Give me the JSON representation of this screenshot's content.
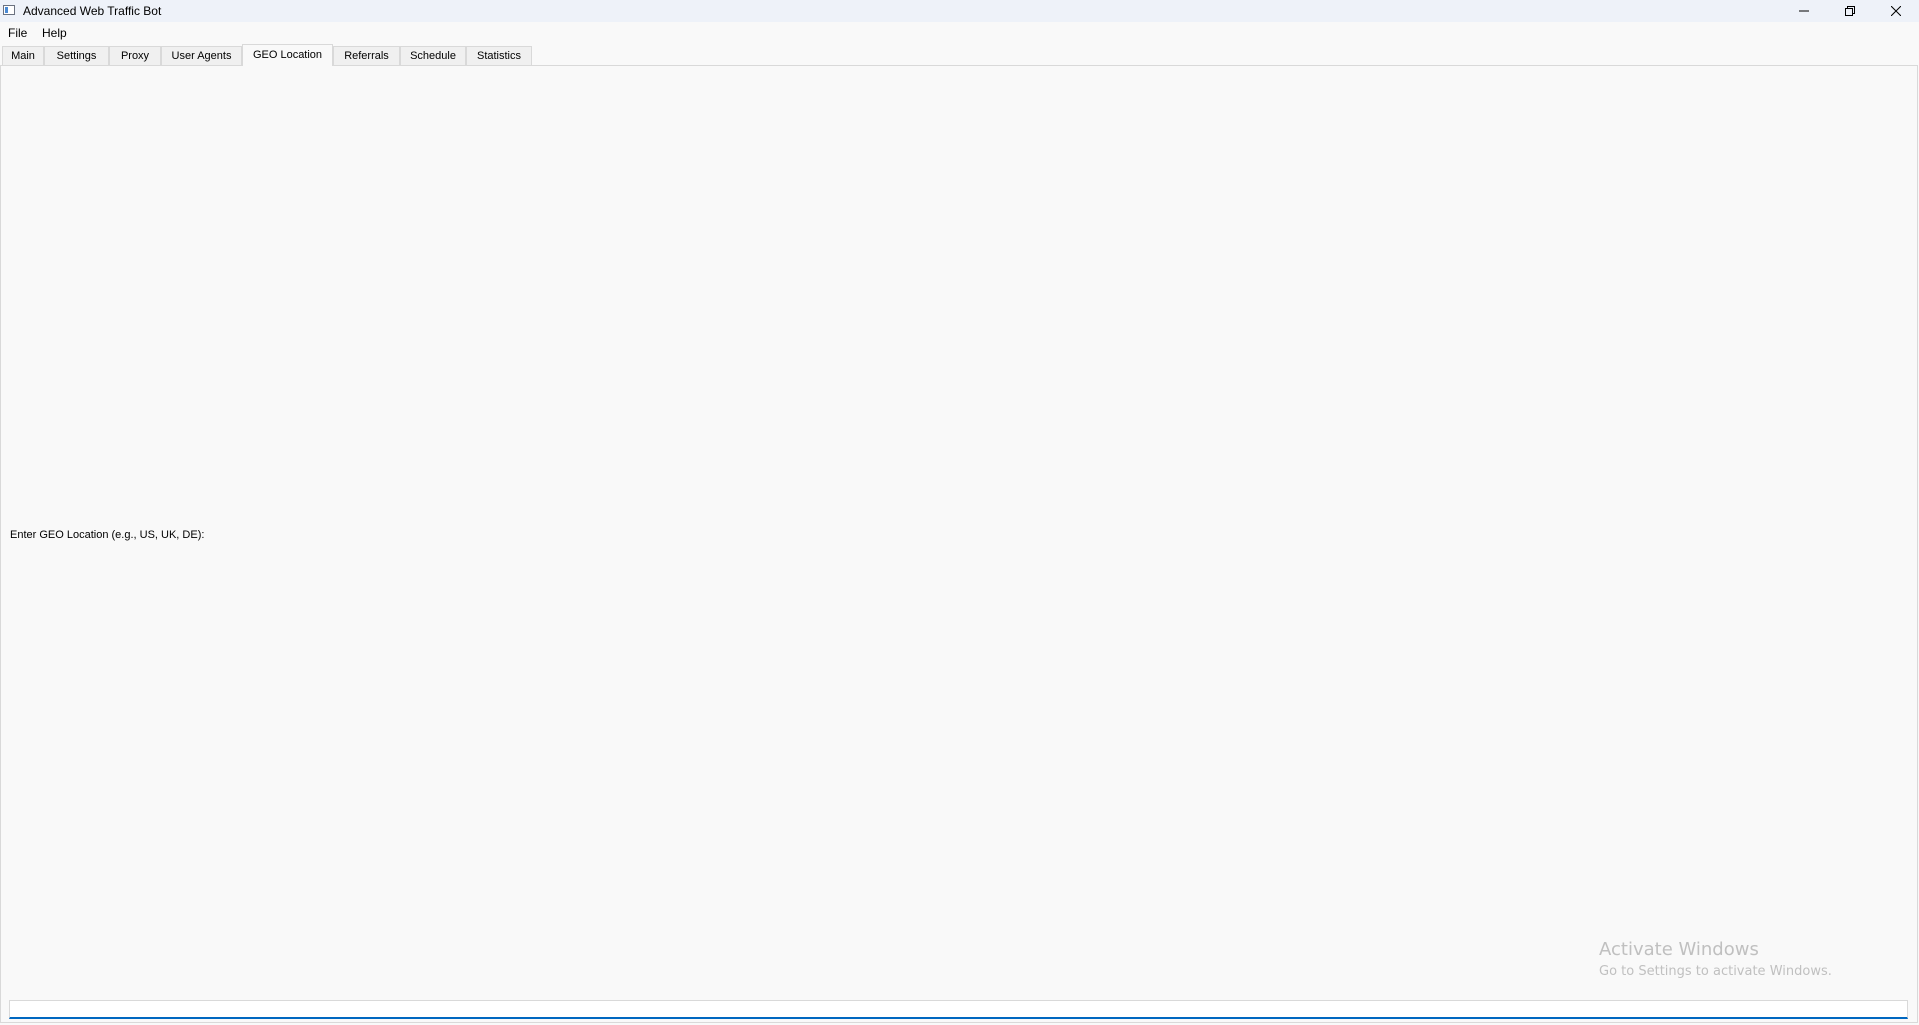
{
  "window": {
    "title": "Advanced Web Traffic Bot"
  },
  "menu": {
    "file": "File",
    "help": "Help"
  },
  "tabs": [
    {
      "label": "Main"
    },
    {
      "label": "Settings"
    },
    {
      "label": "Proxy"
    },
    {
      "label": "User Agents"
    },
    {
      "label": "GEO Location",
      "active": true
    },
    {
      "label": "Referrals"
    },
    {
      "label": "Schedule"
    },
    {
      "label": "Statistics"
    }
  ],
  "geo": {
    "label": "Enter GEO Location (e.g., US, UK, DE):",
    "input_value": ""
  },
  "watermark": {
    "title": "Activate Windows",
    "subtitle": "Go to Settings to activate Windows."
  },
  "colors": {
    "accent": "#0067c0",
    "titlebar": "#eef2f9",
    "background": "#f9f9f9"
  },
  "icons": {
    "app": "app-window-icon",
    "minimize": "minimize-icon",
    "maximize": "restore-icon",
    "close": "close-icon"
  }
}
